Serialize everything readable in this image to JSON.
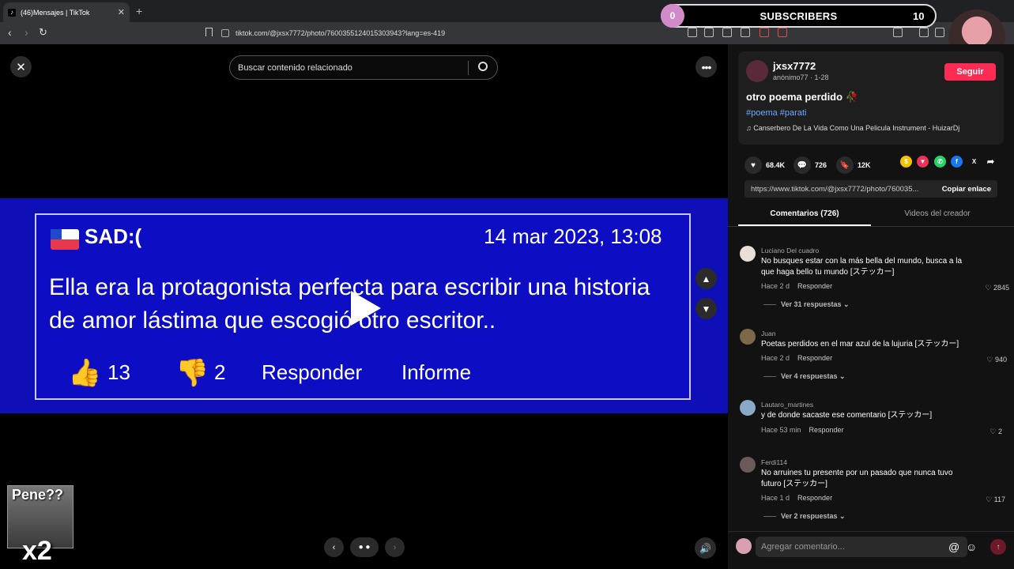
{
  "browser": {
    "tab_title": "(46)Mensajes | TikTok",
    "url": "tiktok.com/@jxsx7772/photo/7600355124015303943?lang=es-419"
  },
  "overlay": {
    "subs_count": "0",
    "subs_label": "SUBSCRIBERS",
    "subs_goal": "10"
  },
  "viewer": {
    "search_placeholder": "Buscar contenido relacionado",
    "card": {
      "name": "SAD:(",
      "date": "14 mar 2023, 13:08",
      "text": "Ella era la protagonista perfecta para escribir una historia de amor lástima que escogió otro escritor..",
      "likes": "13",
      "dislikes": "2",
      "reply_label": "Responder",
      "report_label": "Informe"
    },
    "sticker_text": "Pene??",
    "sticker_multiplier": "x2"
  },
  "post": {
    "username": "jxsx7772",
    "subline": "anónimo77 · 1-28",
    "follow_label": "Seguir",
    "title": "otro poema perdido 🥀",
    "tags": "#poema #parati",
    "music": "Canserbero De La Vida Como Una Pelicula Instrument - HuizarDj",
    "likes": "68.4K",
    "comments": "726",
    "saves": "12K",
    "link": "https://www.tiktok.com/@jxsx7772/photo/760035...",
    "copy_label": "Copiar enlace",
    "tab_comments": "Comentarios (726)",
    "tab_videos": "Videos del creador"
  },
  "comments": [
    {
      "name": "Luciano Del cuadro",
      "text": "No busques estar con la más bella del mundo, busca a la que haga bello tu mundo [ステッカー]",
      "time": "Hace 2 d",
      "reply": "Responder",
      "likes": "2845",
      "replies": "Ver 31 respuestas ⌄",
      "color": "#e8e0d8"
    },
    {
      "name": "Juan",
      "text": "Poetas perdidos en el mar azul de la lujuria [ステッカー]",
      "time": "Hace 2 d",
      "reply": "Responder",
      "likes": "940",
      "replies": "Ver 4 respuestas ⌄",
      "color": "#7a6a4a"
    },
    {
      "name": "Lautaro_martines",
      "text": "y de donde sacaste ese comentario [ステッカー]",
      "time": "Hace 53 min",
      "reply": "Responder",
      "likes": "2",
      "replies": "",
      "color": "#8aa8c8"
    },
    {
      "name": "Ferdi114",
      "text": "No arruines tu presente por un pasado que nunca tuvo futuro [ステッカー]",
      "time": "Hace 1 d",
      "reply": "Responder",
      "likes": "117",
      "replies": "Ver 2 respuestas ⌄",
      "color": "#6a5a5a"
    }
  ],
  "composer": {
    "placeholder": "Agregar comentario..."
  }
}
